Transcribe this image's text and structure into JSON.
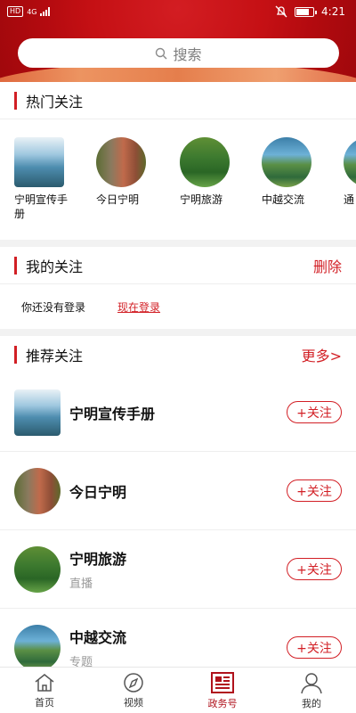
{
  "status_bar": {
    "left": "HD 4G",
    "time": "4:21"
  },
  "search": {
    "placeholder": "搜索"
  },
  "hot": {
    "title": "热门关注",
    "items": [
      {
        "label": "宁明宣传手册",
        "icon": "book-cover"
      },
      {
        "label": "今日宁明",
        "icon": "cliff-photo"
      },
      {
        "label": "宁明旅游",
        "icon": "green-hills-photo"
      },
      {
        "label": "中越交流",
        "icon": "lake-mountain-photo"
      },
      {
        "label": "通",
        "icon": "photo"
      }
    ]
  },
  "my_follow": {
    "title": "我的关注",
    "action": "删除",
    "not_logged_text": "你还没有登录",
    "login_link": "现在登录"
  },
  "recommend": {
    "title": "推荐关注",
    "more": "更多>",
    "items": [
      {
        "name": "宁明宣传手册",
        "sub": "",
        "button": "+关注"
      },
      {
        "name": "今日宁明",
        "sub": "",
        "button": "+关注"
      },
      {
        "name": "宁明旅游",
        "sub": "直播",
        "button": "+关注"
      },
      {
        "name": "中越交流",
        "sub": "专题",
        "button": "+关注"
      }
    ]
  },
  "bottom_nav": [
    {
      "label": "首页",
      "icon": "home-icon"
    },
    {
      "label": "视频",
      "icon": "compass-icon"
    },
    {
      "label": "政务号",
      "icon": "news-icon",
      "active": true
    },
    {
      "label": "我的",
      "icon": "user-icon"
    }
  ],
  "colors": {
    "brand_red": "#d21f25",
    "header_red": "#c51014"
  }
}
